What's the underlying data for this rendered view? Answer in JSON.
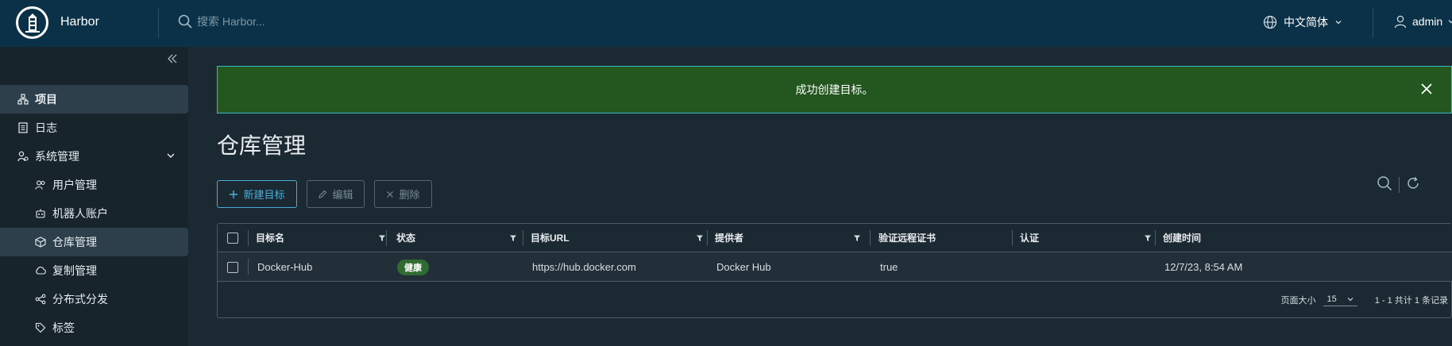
{
  "header": {
    "brand": "Harbor",
    "search_placeholder": "搜索 Harbor...",
    "language": "中文简体",
    "user": "admin"
  },
  "sidebar": {
    "items": [
      {
        "label": "项目",
        "icon": "projects-icon",
        "active": true
      },
      {
        "label": "日志",
        "icon": "logs-icon"
      },
      {
        "label": "系统管理",
        "icon": "admin-icon",
        "expandable": true
      },
      {
        "label": "用户管理",
        "icon": "users-icon",
        "sub": true
      },
      {
        "label": "机器人账户",
        "icon": "robot-icon",
        "sub": true
      },
      {
        "label": "仓库管理",
        "icon": "registry-icon",
        "sub": true,
        "active": true
      },
      {
        "label": "复制管理",
        "icon": "replication-icon",
        "sub": true
      },
      {
        "label": "分布式分发",
        "icon": "distribution-icon",
        "sub": true
      },
      {
        "label": "标签",
        "icon": "tag-icon",
        "sub": true
      }
    ]
  },
  "alert": {
    "message": "成功创建目标。"
  },
  "page": {
    "title": "仓库管理"
  },
  "toolbar": {
    "new": "新建目标",
    "edit": "编辑",
    "delete": "删除"
  },
  "table": {
    "columns": [
      "目标名",
      "状态",
      "目标URL",
      "提供者",
      "验证远程证书",
      "认证",
      "创建时间"
    ],
    "rows": [
      {
        "name": "Docker-Hub",
        "status": "健康",
        "url": "https://hub.docker.com",
        "provider": "Docker Hub",
        "verify": "true",
        "auth": "",
        "created": "12/7/23, 8:54 AM"
      }
    ],
    "page_size_label": "页面大小",
    "page_size": "15",
    "summary": "1 - 1 共计 1 条记录"
  },
  "colors": {
    "header_bg": "#0a3147",
    "alert_success": "#23571f",
    "primary": "#49afd9",
    "badge_healthy": "#306b34"
  }
}
